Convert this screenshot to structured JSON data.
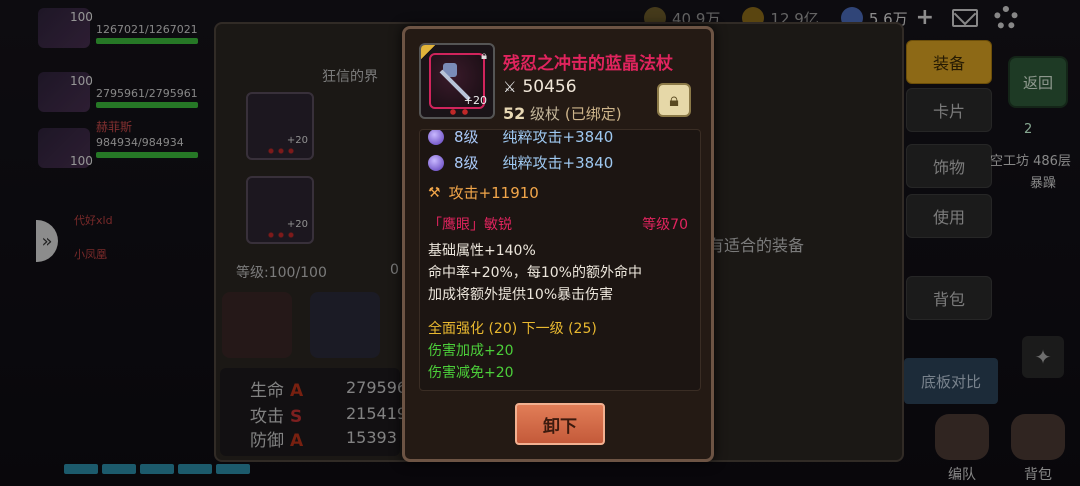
{
  "topbar": {
    "res1_value": "40.9万",
    "res2_value": "12.9亿",
    "res3_value": "5.6万",
    "plus_label": "+"
  },
  "team": {
    "members": [
      {
        "level": "100",
        "hp": "1267021/1267021",
        "hp_fraction": 1.0
      },
      {
        "level": "100",
        "hp": "2795961/2795961",
        "hp_fraction": 1.0
      },
      {
        "level": "100",
        "hp": "984934/984934",
        "hp_fraction": 1.0
      }
    ],
    "member_name": "赫菲斯",
    "extra_names": [
      "代好xld",
      "小凤凰"
    ]
  },
  "backpanel": {
    "fanatic_label": "狂信的界",
    "slot_plus": "+20",
    "level_text": "等级:100/100",
    "level_text2": "0",
    "stats": [
      {
        "label": "生命",
        "grade": "A",
        "value": "279596"
      },
      {
        "label": "攻击",
        "grade": "S",
        "value": "215419"
      },
      {
        "label": "防御",
        "grade": "A",
        "value": "15393"
      }
    ],
    "no_equip": "有适合的装备"
  },
  "rnav": {
    "tabs": [
      "装备",
      "卡片",
      "饰物",
      "使用",
      "背包"
    ],
    "back": "返回",
    "gem_count": "2",
    "workshop": "空工坊 486层",
    "baoliao": "暴躁",
    "compare": "底板对比",
    "team": "编队",
    "bag": "背包"
  },
  "tooltip": {
    "title": "残忍之冲击的蓝晶法杖",
    "power": "50456",
    "level_num": "52",
    "type": "级杖",
    "bound": "(已绑定)",
    "plus": "+20",
    "gems": [
      {
        "level": "8级",
        "stat": "纯粹攻击+3840"
      },
      {
        "level": "8级",
        "stat": "纯粹攻击+3840"
      }
    ],
    "attack": "攻击+11910",
    "passive_name": "「鹰眼」敏锐",
    "passive_level": "等级70",
    "passive_lines": [
      "基础属性+140%",
      "命中率+20%，每10%的额外命中",
      "加成将额外提供10%暴击伤害"
    ],
    "enhance": "全面强化 (20) 下一级 (25)",
    "bonuses": [
      "伤害加成+20",
      "伤害减免+20"
    ],
    "unequip": "卸下"
  },
  "colors": {
    "title_pink": "#e0245e",
    "gem_blue": "#9ec8f0",
    "attack_orange": "#f2a64a",
    "enhance_gold": "#e8b830",
    "bonus_green": "#4ccf3a",
    "button_orange": "#d96a47",
    "active_tab_gold": "#d9a223"
  }
}
